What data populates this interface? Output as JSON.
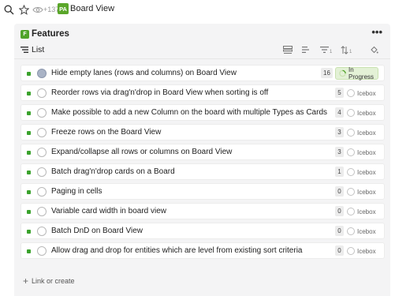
{
  "topbar": {
    "count": "+137",
    "badge": "PA",
    "title": "Board View",
    "icons": [
      "search-icon",
      "star-icon",
      "eye-icon"
    ]
  },
  "panel": {
    "badge": "F",
    "title": "Features",
    "more": "•••",
    "view_label": "List",
    "tool_counts": {
      "filter": "1",
      "sort": "1"
    },
    "colors": {
      "badge_green": "#4fa32a",
      "status_square": "#3aa22c",
      "in_progress_bg": "#e3f1d6"
    }
  },
  "rows": [
    {
      "text": "Hide empty lanes (rows and columns) on Board View",
      "count": "16",
      "status": "In Progress",
      "assignee": true
    },
    {
      "text": "Reorder rows via drag'n'drop in Board View when sorting is off",
      "count": "5",
      "status": "Icebox",
      "assignee": false
    },
    {
      "text": "Make possible to add a new Column on the board with multiple Types as Cards",
      "count": "4",
      "status": "Icebox",
      "assignee": false
    },
    {
      "text": "Freeze rows on the Board View",
      "count": "3",
      "status": "Icebox",
      "assignee": false
    },
    {
      "text": "Expand/collapse all rows or columns on Board View",
      "count": "3",
      "status": "Icebox",
      "assignee": false
    },
    {
      "text": "Batch drag'n'drop cards on a Board",
      "count": "1",
      "status": "Icebox",
      "assignee": false
    },
    {
      "text": "Paging in cells",
      "count": "0",
      "status": "Icebox",
      "assignee": false
    },
    {
      "text": "Variable card width in board view",
      "count": "0",
      "status": "Icebox",
      "assignee": false
    },
    {
      "text": "Batch DnD on Board View",
      "count": "0",
      "status": "Icebox",
      "assignee": false
    },
    {
      "text": "Allow drag and drop for entities which are level from existing sort criteria",
      "count": "0",
      "status": "Icebox",
      "assignee": false
    }
  ],
  "footer": {
    "link_label": "Link or create"
  }
}
